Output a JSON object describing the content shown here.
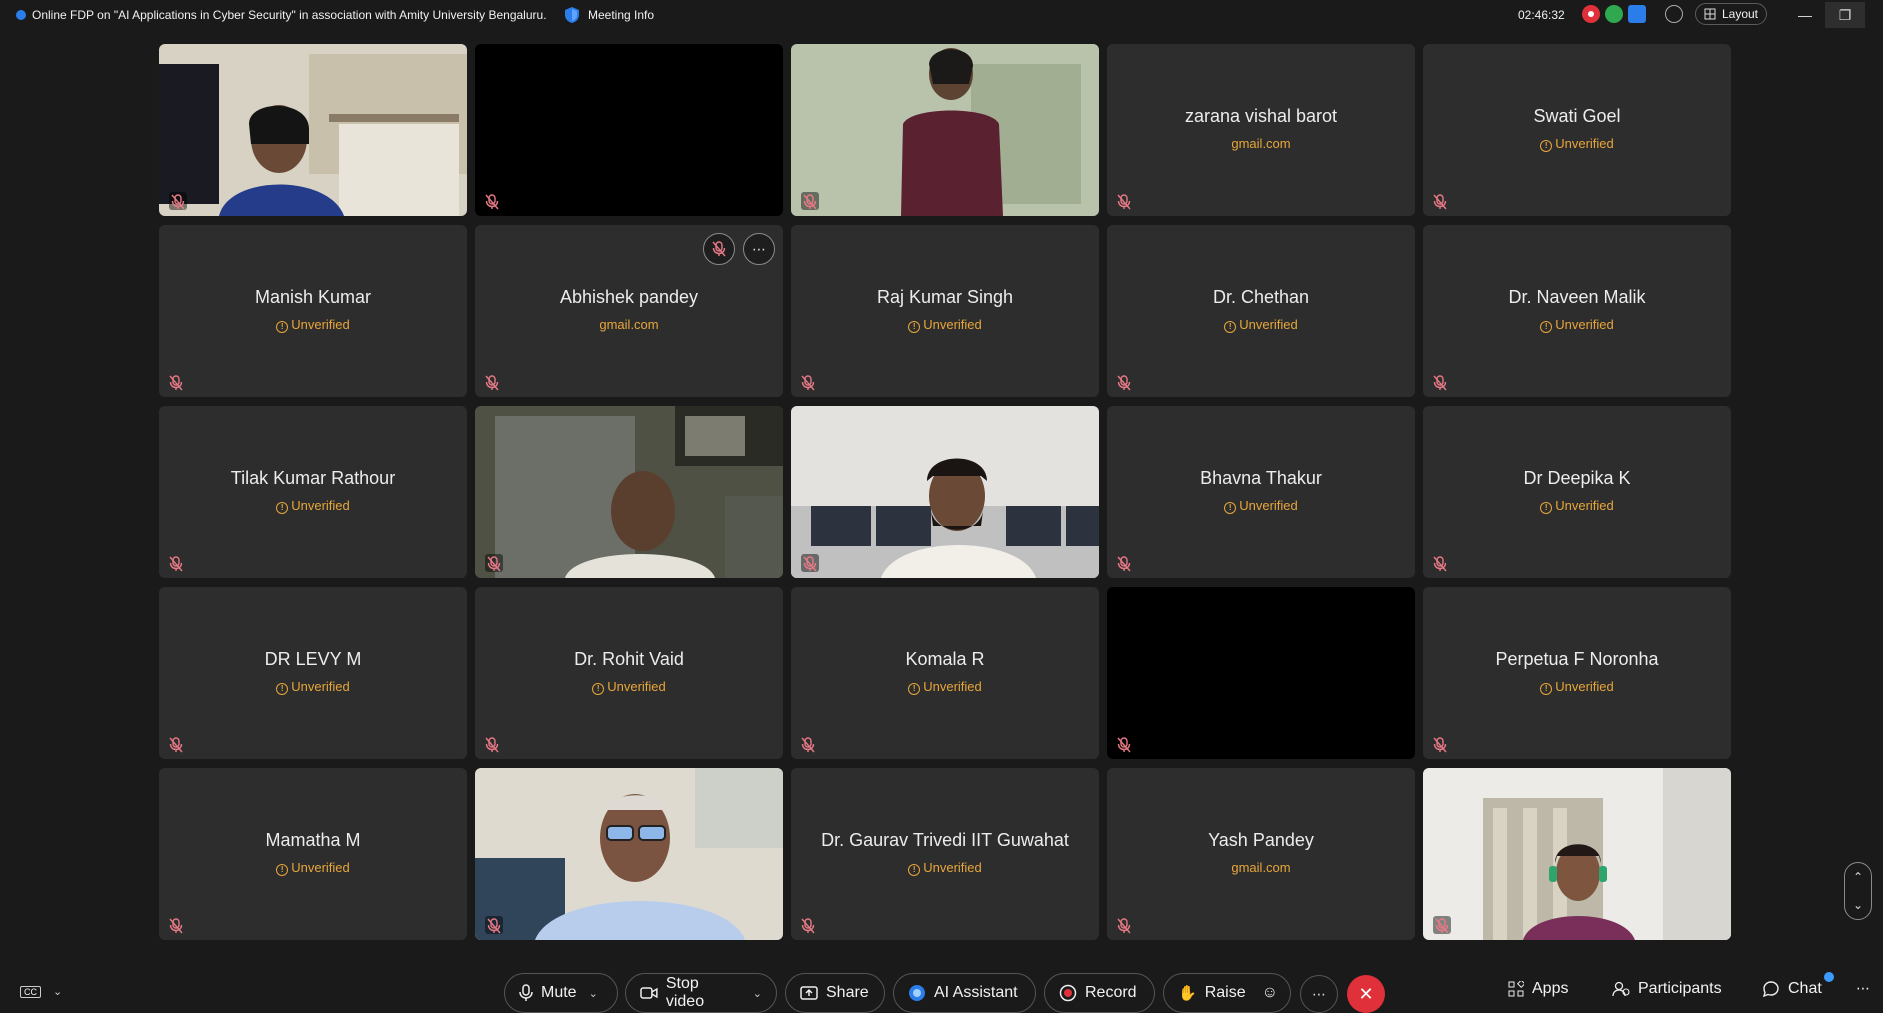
{
  "window": {
    "title": "Online FDP on \"AI Applications in Cyber Security\" in association with Amity University Bengaluru.",
    "meeting_info": "Meeting Info",
    "time": "02:46:32",
    "layout_label": "Layout"
  },
  "participants": [
    {
      "name": "",
      "sub": "",
      "video": "woman-office"
    },
    {
      "name": "",
      "sub": "",
      "video": "black"
    },
    {
      "name": "",
      "sub": "",
      "video": "woman-standing"
    },
    {
      "name": "zarana vishal barot",
      "sub": "gmail.com",
      "verified": true
    },
    {
      "name": "Swati Goel",
      "sub": "Unverified"
    },
    {
      "name": "Manish Kumar",
      "sub": "Unverified"
    },
    {
      "name": "Abhishek pandey",
      "sub": "gmail.com",
      "verified": true,
      "hover_actions": true
    },
    {
      "name": "Raj Kumar Singh",
      "sub": "Unverified"
    },
    {
      "name": "Dr. Chethan",
      "sub": "Unverified"
    },
    {
      "name": "Dr. Naveen Malik",
      "sub": "Unverified"
    },
    {
      "name": "Tilak Kumar Rathour",
      "sub": "Unverified"
    },
    {
      "name": "",
      "sub": "",
      "video": "man-cabinet"
    },
    {
      "name": "",
      "sub": "",
      "video": "man-lab"
    },
    {
      "name": "Bhavna Thakur",
      "sub": "Unverified"
    },
    {
      "name": "Dr Deepika K",
      "sub": "Unverified"
    },
    {
      "name": "DR LEVY M",
      "sub": "Unverified"
    },
    {
      "name": "Dr. Rohit Vaid",
      "sub": "Unverified"
    },
    {
      "name": "Komala R",
      "sub": "Unverified"
    },
    {
      "name": "",
      "sub": "",
      "video": "black"
    },
    {
      "name": "Perpetua F Noronha",
      "sub": "Unverified"
    },
    {
      "name": "Mamatha M",
      "sub": "Unverified"
    },
    {
      "name": "",
      "sub": "",
      "video": "man-glasses"
    },
    {
      "name": "Dr. Gaurav Trivedi IIT Guwahat",
      "sub": "Unverified"
    },
    {
      "name": "Yash Pandey",
      "sub": "gmail.com",
      "verified": true
    },
    {
      "name": "",
      "sub": "",
      "video": "woman-headset"
    }
  ],
  "toolbar": {
    "mute": "Mute",
    "stop_video": "Stop video",
    "share": "Share",
    "ai_assistant": "AI Assistant",
    "record": "Record",
    "raise": "Raise",
    "apps": "Apps",
    "participants": "Participants",
    "chat": "Chat"
  },
  "colors": {
    "background": "#1a1a1a",
    "tile": "#2d2d2d",
    "unverified": "#e8a63a",
    "end_call": "#e0313a",
    "muted_mic": "#e87a86"
  }
}
